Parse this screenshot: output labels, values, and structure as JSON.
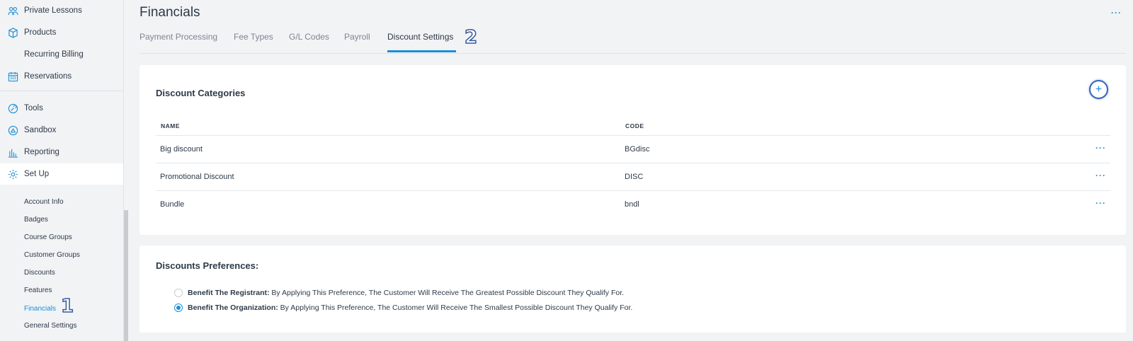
{
  "sidebar": {
    "nav": [
      {
        "label": "Private Lessons",
        "icon": "people-icon"
      },
      {
        "label": "Products",
        "icon": "box-icon"
      },
      {
        "label": "Recurring Billing",
        "icon": ""
      },
      {
        "label": "Reservations",
        "icon": "calendar-icon"
      },
      {
        "label": "Tools",
        "icon": "tools-icon"
      },
      {
        "label": "Sandbox",
        "icon": "sandbox-icon"
      },
      {
        "label": "Reporting",
        "icon": "bar-chart-icon"
      },
      {
        "label": "Set Up",
        "icon": "gear-icon"
      }
    ],
    "setup_items": [
      "Account Info",
      "Badges",
      "Course Groups",
      "Customer Groups",
      "Discounts",
      "Features",
      "Financials",
      "General Settings"
    ]
  },
  "annotations": {
    "step1": "1",
    "step2": "2"
  },
  "page": {
    "title": "Financials",
    "more": "···",
    "tabs": [
      "Payment Processing",
      "Fee Types",
      "G/L Codes",
      "Payroll",
      "Discount Settings"
    ]
  },
  "discount_categories": {
    "title": "Discount Categories",
    "add": "+",
    "columns": [
      "NAME",
      "CODE"
    ],
    "rows": [
      {
        "name": "Big discount",
        "code": "BGdisc",
        "more": "···"
      },
      {
        "name": "Promotional Discount",
        "code": "DISC",
        "more": "···"
      },
      {
        "name": "Bundle",
        "code": "bndl",
        "more": "···"
      }
    ]
  },
  "preferences": {
    "title": "Discounts Preferences:",
    "options": [
      {
        "label": "Benefit The Registrant:",
        "text": " By Applying This Preference, The Customer Will Receive The Greatest Possible Discount They Qualify For.",
        "checked": false
      },
      {
        "label": "Benefit The Organization:",
        "text": " By Applying This Preference, The Customer Will Receive The Smallest Possible Discount They Qualify For.",
        "checked": true
      }
    ]
  },
  "colors": {
    "accent": "#1a8fd6",
    "annotation": "#355a9c"
  }
}
